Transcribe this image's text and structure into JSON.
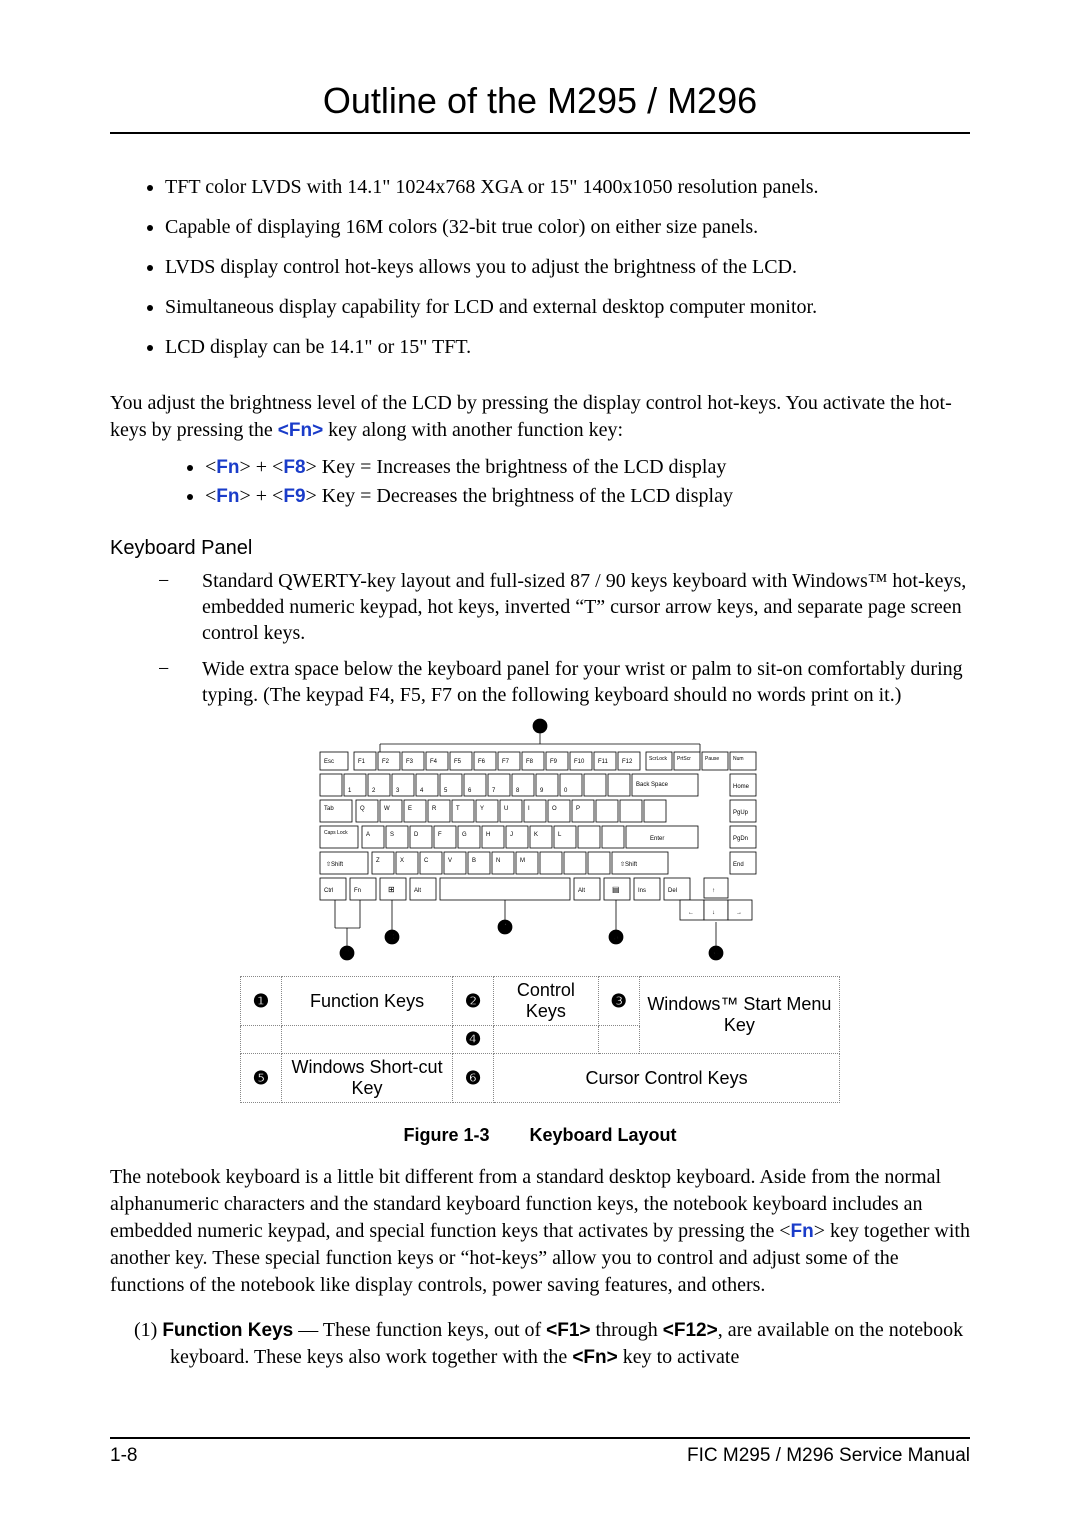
{
  "title": "Outline of the M295 / M296",
  "bullets_top": [
    "TFT color LVDS with 14.1\" 1024x768 XGA or 15\" 1400x1050 resolution panels.",
    "Capable of displaying 16M colors (32-bit true color) on either size panels.",
    "LVDS display control hot-keys allows you to adjust the brightness of the LCD.",
    "Simultaneous display capability for LCD and external desktop computer monitor.",
    "LCD display can be 14.1\" or 15\" TFT."
  ],
  "para1_pre": "You adjust the brightness level of the LCD by pressing the display control hot-keys. You activate the hot-keys by pressing the ",
  "para1_fn": "<Fn>",
  "para1_post": " key along with another function key:",
  "hotkeys": [
    {
      "lt": "<",
      "k1": "Fn",
      "gt": ">",
      "plus": " + <",
      "k2": "F8",
      "tail": ">  Key = Increases the brightness of the LCD display"
    },
    {
      "lt": "<",
      "k1": "Fn",
      "gt": ">",
      "plus": " + <",
      "k2": "F9",
      "tail": ">  Key = Decreases the brightness of the LCD display"
    }
  ],
  "kbd_heading": "Keyboard Panel",
  "kbd_dashes": [
    "Standard QWERTY-key layout and full-sized 87 / 90 keys keyboard with Windows™ hot-keys, embedded numeric keypad, hot keys, inverted “T” cursor arrow keys, and separate page screen control keys.",
    "Wide extra space below the keyboard panel for your wrist or palm to sit-on comfortably during typing. (The keypad F4, F5, F7 on the following keyboard should no words print on it.)"
  ],
  "legend": {
    "n1": "❶",
    "t1": "Function Keys",
    "n2": "❷",
    "t2": "Control Keys",
    "n3": "❸",
    "t3": "Windows™ Start Menu Key",
    "n4": "❹",
    "n5": "❺",
    "t5": "Windows Short-cut Key",
    "n6": "❻",
    "t6": "Cursor Control Keys"
  },
  "caption_label": "Figure 1-3",
  "caption_text": "Keyboard Layout",
  "para2_a": "The notebook keyboard is a little bit different from a standard desktop keyboard. Aside from the normal alphanumeric characters and the standard keyboard function keys, the notebook keyboard includes an embedded numeric keypad, and special function keys that activates by pressing the <",
  "para2_fn": "Fn",
  "para2_b": "> key together with another key. These special function keys or “hot-keys” allow you to control and adjust some of the functions of the notebook like display controls, power saving features, and others.",
  "numitem_pre": "(1)  ",
  "numitem_bold": "Function Keys",
  "numitem_mid": " — These function keys, out of ",
  "numitem_f1": "<F1>",
  "numitem_mid2": " through ",
  "numitem_f12": "<F12>",
  "numitem_mid3": ", are available on the notebook keyboard. These keys also work together with the ",
  "numitem_fn": "<Fn>",
  "numitem_tail": " key to activate",
  "footer_left": "1-8",
  "footer_right": "FIC M295 / M296 Service Manual"
}
